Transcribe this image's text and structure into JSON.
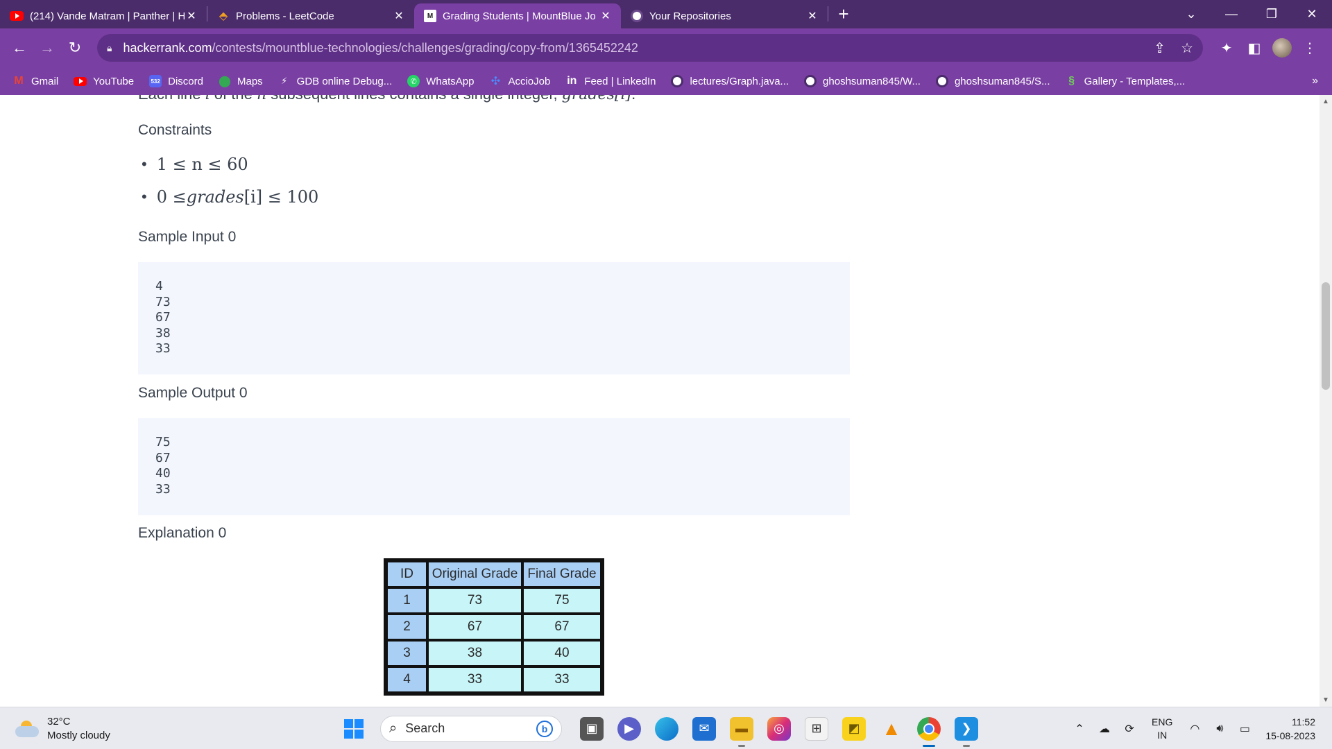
{
  "browser": {
    "tabs": [
      {
        "title": "(214) Vande Matram | Panther | H",
        "icon": "youtube-icon",
        "active": false
      },
      {
        "title": "Problems - LeetCode",
        "icon": "leetcode-icon",
        "active": false
      },
      {
        "title": "Grading Students | MountBlue Jo",
        "icon": "hackerrank-icon",
        "active": true
      },
      {
        "title": "Your Repositories",
        "icon": "github-icon",
        "active": false
      }
    ],
    "url_host": "hackerrank.com",
    "url_path": "/contests/mountblue-technologies/challenges/grading/copy-from/1365452242",
    "bookmarks": [
      {
        "label": "Gmail",
        "icon": "gmail-icon"
      },
      {
        "label": "YouTube",
        "icon": "youtube-icon"
      },
      {
        "label": "Discord",
        "icon": "discord-icon",
        "badge": "532"
      },
      {
        "label": "Maps",
        "icon": "maps-icon"
      },
      {
        "label": "GDB online Debug...",
        "icon": "gdb-icon"
      },
      {
        "label": "WhatsApp",
        "icon": "whatsapp-icon"
      },
      {
        "label": "AccioJob",
        "icon": "acciojob-icon"
      },
      {
        "label": "Feed | LinkedIn",
        "icon": "linkedin-icon",
        "glyph": "in"
      },
      {
        "label": "lectures/Graph.java...",
        "icon": "github-icon"
      },
      {
        "label": "ghoshsuman845/W...",
        "icon": "github-icon"
      },
      {
        "label": "ghoshsuman845/S...",
        "icon": "github-icon"
      },
      {
        "label": "Gallery - Templates,...",
        "icon": "gallery-icon"
      }
    ],
    "bookmarks_overflow": "»"
  },
  "content": {
    "cut_line_prefix": "Each line ",
    "cut_line_i": "i",
    "cut_line_mid1": " of the ",
    "cut_line_n": "n",
    "cut_line_mid2": " subsequent lines contains a single integer, ",
    "cut_line_var": "grades",
    "cut_line_index": "[i]",
    "cut_line_end": ".",
    "constraints_title": "Constraints",
    "constraint_1": "1 ≤ n ≤ 60",
    "constraint_2_pre": "0 ≤ ",
    "constraint_2_var": "grades",
    "constraint_2_post": "[i] ≤ 100",
    "sample_input_title": "Sample Input 0",
    "sample_input": "4\n73\n67\n38\n33",
    "sample_output_title": "Sample Output 0",
    "sample_output": "75\n67\n40\n33",
    "explanation_title": "Explanation 0",
    "table": {
      "headers": [
        "ID",
        "Original Grade",
        "Final Grade"
      ],
      "rows": [
        [
          "1",
          "73",
          "75"
        ],
        [
          "2",
          "67",
          "67"
        ],
        [
          "3",
          "38",
          "40"
        ],
        [
          "4",
          "33",
          "33"
        ]
      ]
    }
  },
  "taskbar": {
    "temperature": "32°C",
    "weather": "Mostly cloudy",
    "search_placeholder": "Search",
    "lang_top": "ENG",
    "lang_bottom": "IN",
    "time": "11:52",
    "date": "15-08-2023"
  }
}
